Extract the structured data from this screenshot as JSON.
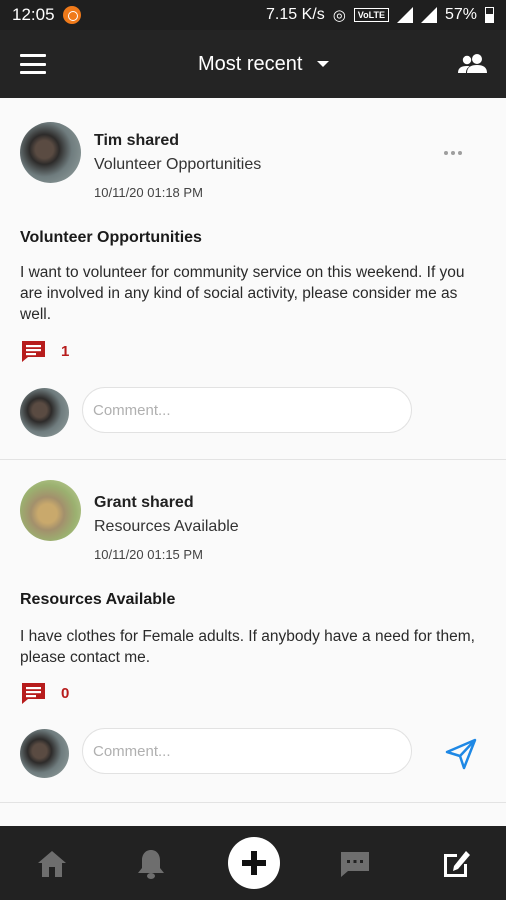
{
  "status_bar": {
    "time": "12:05",
    "network_speed": "7.15 K/s",
    "volte": "VoLTE",
    "battery": "57%"
  },
  "app_bar": {
    "title": "Most recent",
    "icons": {
      "menu": "hamburger-menu-icon",
      "dropdown": "chevron-down-icon",
      "people": "people-icon"
    }
  },
  "posts": [
    {
      "author_line": "Tim shared",
      "subject": "Volunteer Opportunities",
      "timestamp": "10/11/20 01:18 PM",
      "title": "Volunteer Opportunities",
      "body": "I want to volunteer for community service on this weekend. If you are involved in any kind of social activity, please consider me as well.",
      "comment_count": "1",
      "comment_placeholder": "Comment..."
    },
    {
      "author_line": "Grant shared",
      "subject": "Resources Available",
      "timestamp": "10/11/20 01:15 PM",
      "title": "Resources Available",
      "body": "I have clothes for Female adults. If anybody have a need for them, please contact me.",
      "comment_count": "0",
      "comment_placeholder": "Comment..."
    }
  ],
  "colors": {
    "app_bar": "#242424",
    "comment_icon": "#b71c1c",
    "send_icon": "#1e88e5",
    "bottom_nav": "#222222"
  },
  "bottom_nav": {
    "items": [
      "home-icon",
      "bell-icon",
      "add-icon",
      "chat-icon",
      "edit-icon"
    ]
  }
}
